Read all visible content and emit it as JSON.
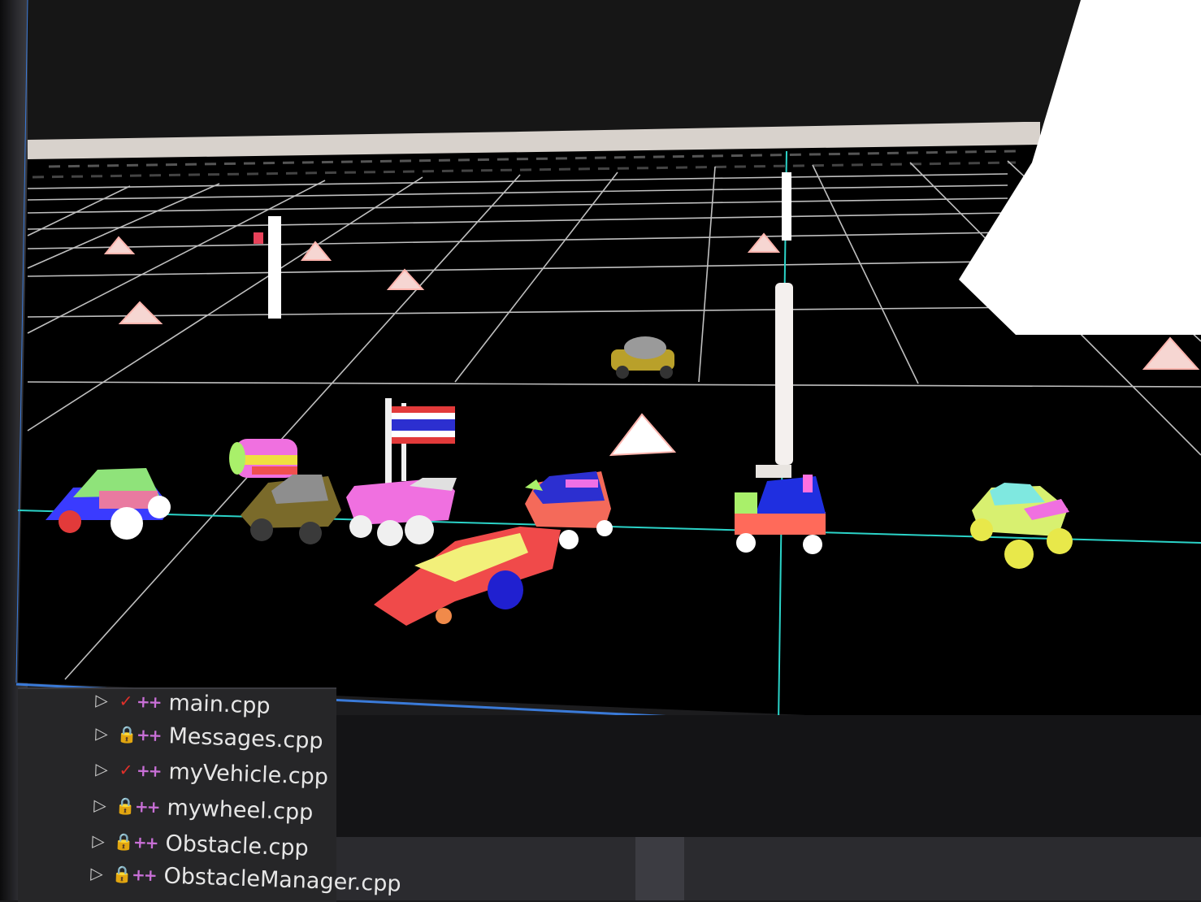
{
  "viewport": {
    "background_color": "#000000",
    "grid_color": "#c8c8c8",
    "axis_color": "#2bd3c8",
    "wall_color": "#d6d0cc"
  },
  "solution_explorer": {
    "files": [
      {
        "name": "main.cpp",
        "status_icon": "check-icon",
        "lang_icon": "cpp-icon",
        "lang_label": "++"
      },
      {
        "name": "Messages.cpp",
        "status_icon": "lock-icon",
        "lang_icon": "cpp-icon",
        "lang_label": "++"
      },
      {
        "name": "myVehicle.cpp",
        "status_icon": "check-icon",
        "lang_icon": "cpp-icon",
        "lang_label": "++"
      },
      {
        "name": "mywheel.cpp",
        "status_icon": "lock-icon",
        "lang_icon": "cpp-icon",
        "lang_label": "++"
      },
      {
        "name": "Obstacle.cpp",
        "status_icon": "lock-icon",
        "lang_icon": "cpp-icon",
        "lang_label": "++"
      },
      {
        "name": "ObstacleManager.cpp",
        "status_icon": "lock-icon",
        "lang_icon": "cpp-icon",
        "lang_label": "++"
      }
    ],
    "expander_glyph": "▷",
    "check_glyph": "✓",
    "lock_glyph": "🔒"
  }
}
